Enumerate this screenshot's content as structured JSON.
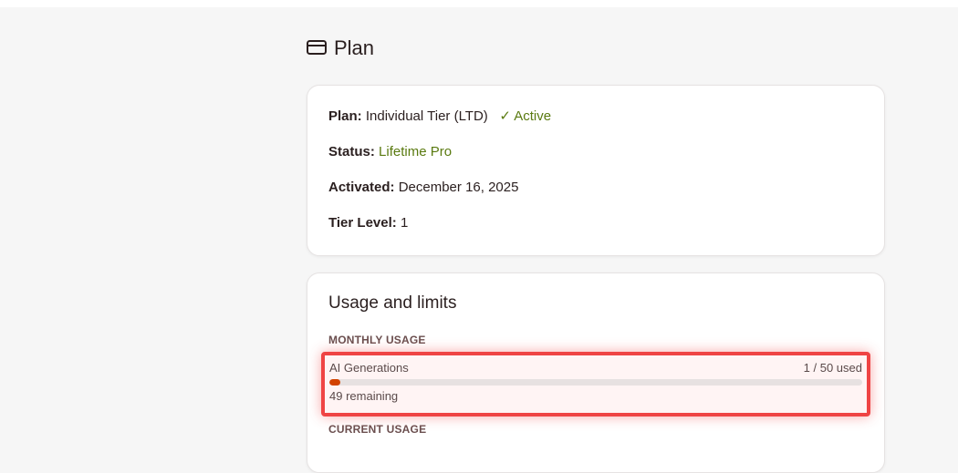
{
  "header": {
    "title": "Plan",
    "icon": "credit-card-icon"
  },
  "plan_card": {
    "plan_label": "Plan:",
    "plan_value": "Individual Tier (LTD)",
    "plan_badge": "✓ Active",
    "status_label": "Status:",
    "status_value": "Lifetime Pro",
    "activated_label": "Activated:",
    "activated_value": "December 16, 2025",
    "tier_label": "Tier Level:",
    "tier_value": "1"
  },
  "usage_card": {
    "title": "Usage and limits",
    "monthly_heading": "MONTHLY USAGE",
    "ai_generations": {
      "label": "AI Generations",
      "used_text": "1 / 50 used",
      "used": 1,
      "limit": 50,
      "remaining_text": "49 remaining"
    },
    "current_heading": "CURRENT USAGE"
  },
  "colors": {
    "accent": "#ef4444",
    "progress": "#d24300",
    "active": "#5a7a10"
  }
}
